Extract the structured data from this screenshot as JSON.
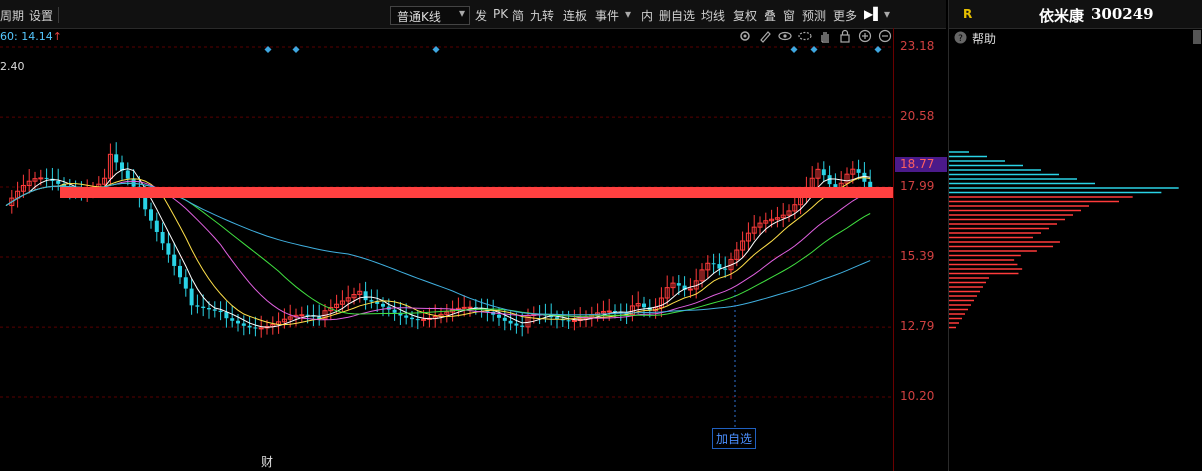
{
  "toolbar": {
    "items_left": [
      "周期",
      "设置"
    ],
    "chart_type": "普通K线",
    "items_right": [
      "发",
      "PK",
      "简",
      "九转",
      "连板",
      "事件",
      "内",
      "删自选",
      "均线",
      "复权",
      "叠",
      "窗",
      "预测",
      "更多"
    ]
  },
  "info": {
    "ma_label": "60: 14.14",
    "sub_label": "2.40"
  },
  "price_axis": {
    "labels": [
      "23.18",
      "20.58",
      "17.99",
      "15.39",
      "12.79",
      "10.20"
    ],
    "current": "18.77"
  },
  "annotations": {
    "add_watchlist": "加自选",
    "financial_marker": "财"
  },
  "right_panel": {
    "tab": "R",
    "stock_name": "依米康",
    "stock_code": "300249",
    "help_label": "帮助"
  },
  "colors": {
    "up": "#ff3b3b",
    "down": "#2ad3e6",
    "highlight_bar": "#ff4040",
    "grid": "#5a0000"
  }
}
